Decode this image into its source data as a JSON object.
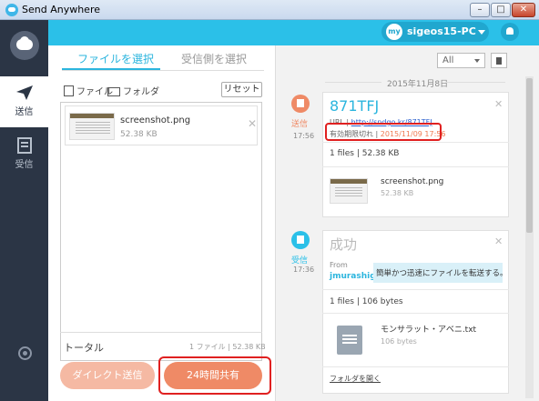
{
  "window": {
    "title": "Send Anywhere",
    "min": "–",
    "max": "□",
    "close": "✕"
  },
  "nav": {
    "send_label": "送信",
    "receive_label": "受信"
  },
  "header": {
    "avatar_text": "my",
    "user_name": "sigeos15-PC"
  },
  "tabs": {
    "select_files": "ファイルを選択",
    "select_receiver": "受信側を選択"
  },
  "toolbar": {
    "file": "ファイル",
    "folder": "フォルダ",
    "reset": "リセット"
  },
  "file_list": {
    "items": [
      {
        "name": "screenshot.png",
        "size": "52.38 KB"
      }
    ],
    "total_label": "トータル",
    "total_value": "1 ファイル | 52.38 KB"
  },
  "buttons": {
    "direct": "ダイレクト送信",
    "share24": "24時間共有"
  },
  "history": {
    "filter_value": "All",
    "date": "2015年11月8日",
    "send_entry": {
      "label": "送信",
      "time": "17:56",
      "code": "871TFJ",
      "url_label": "URL | ",
      "url": "http://sndgo.kr/871TFJ",
      "expire_label": "有効期限切れ",
      "expire_sep": " | ",
      "expire_date": "2015/11/09 17:56",
      "files_summary": "1 files  |  52.38 KB",
      "file_name": "screenshot.png",
      "file_size": "52.38 KB"
    },
    "receive_entry": {
      "label": "受信",
      "time": "17:36",
      "status": "成功",
      "from_label": "From",
      "from_name": "jmurashige",
      "message": "簡単かつ迅速にファイルを転送する。",
      "files_summary": "1 files  |  106 bytes",
      "file_name": "モンサラット・アベニ.txt",
      "file_size": "106 bytes",
      "open_folder": "フォルダを開く"
    }
  },
  "colors": {
    "accent": "#2bc0e8",
    "send": "#ef8a66",
    "nav_bg": "#2b3545",
    "highlight": "#e02020"
  }
}
